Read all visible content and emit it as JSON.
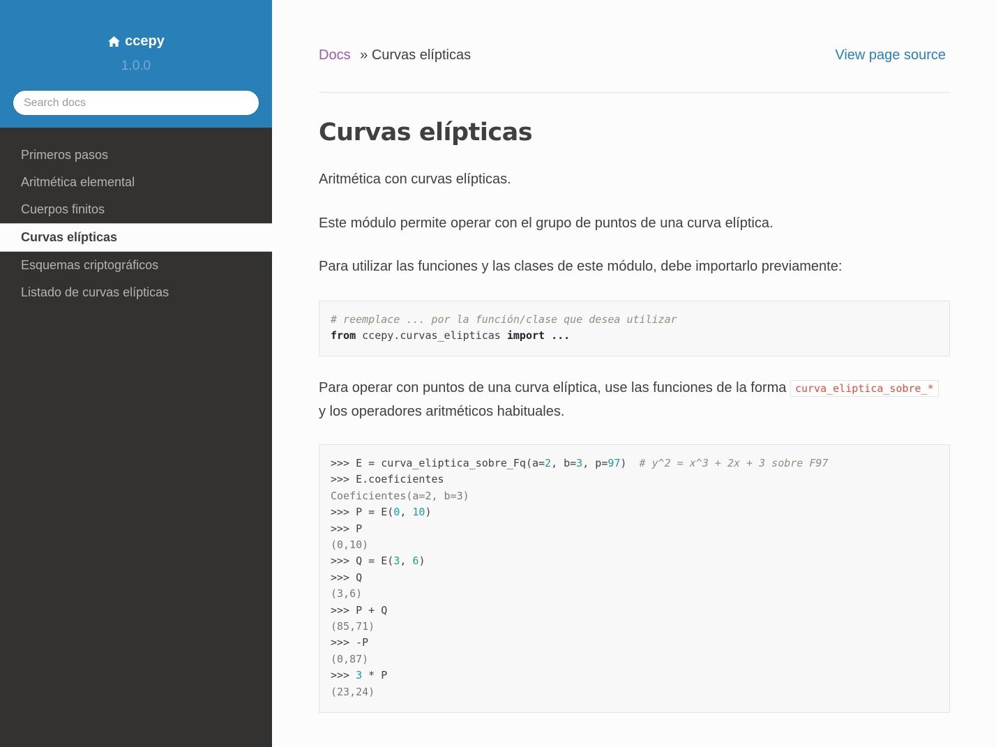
{
  "sidebar": {
    "brand": "ccepy",
    "version": "1.0.0",
    "search_placeholder": "Search docs",
    "items": [
      {
        "label": "Primeros pasos"
      },
      {
        "label": "Aritmética elemental"
      },
      {
        "label": "Cuerpos finitos"
      },
      {
        "label": "Curvas elípticas",
        "current": true
      },
      {
        "label": "Esquemas criptográficos"
      },
      {
        "label": "Listado de curvas elípticas"
      }
    ]
  },
  "breadcrumbs": {
    "docs": "Docs",
    "separator": "»",
    "current": "Curvas elípticas",
    "view_source": "View page source"
  },
  "main": {
    "title": "Curvas elípticas",
    "p1": "Aritmética con curvas elípticas.",
    "p2": "Este módulo permite operar con el grupo de puntos de una curva elíptica.",
    "p3": "Para utilizar las funciones y las clases de este módulo, debe importarlo previamente:",
    "code1": {
      "comment": "# reemplace ... por la función/clase que desea utilizar",
      "from": "from",
      "module": " ccepy.curvas_elipticas ",
      "import": "import",
      "rest": " ..."
    },
    "p4_before": "Para operar con puntos de una curva elíptica, use las funciones de la forma ",
    "p4_code": "curva_eliptica_sobre_*",
    "p4_after": "y los operadores aritméticos habituales.",
    "code2": {
      "l1_a": ">>> E = curva_eliptica_sobre_Fq(a=",
      "l1_n1": "2",
      "l1_b": ", b=",
      "l1_n2": "3",
      "l1_c": ", p=",
      "l1_n3": "97",
      "l1_d": ")  ",
      "l1_comment": "# y^2 = x^3 + 2x + 3 sobre F97",
      "l2": ">>> E.coeficientes",
      "l3": "Coeficientes(a=2, b=3)",
      "l4_a": ">>> P = E(",
      "l4_n1": "0",
      "l4_b": ", ",
      "l4_n2": "10",
      "l4_c": ")",
      "l5": ">>> P",
      "l6": "(0,10)",
      "l7_a": ">>> Q = E(",
      "l7_n1": "3",
      "l7_b": ", ",
      "l7_n2": "6",
      "l7_c": ")",
      "l8": ">>> Q",
      "l9": "(3,6)",
      "l10": ">>> P + Q",
      "l11": "(85,71)",
      "l12": ">>> -P",
      "l13": "(0,87)",
      "l14_a": ">>> ",
      "l14_n": "3",
      "l14_b": " * P",
      "l15": "(23,24)"
    }
  }
}
